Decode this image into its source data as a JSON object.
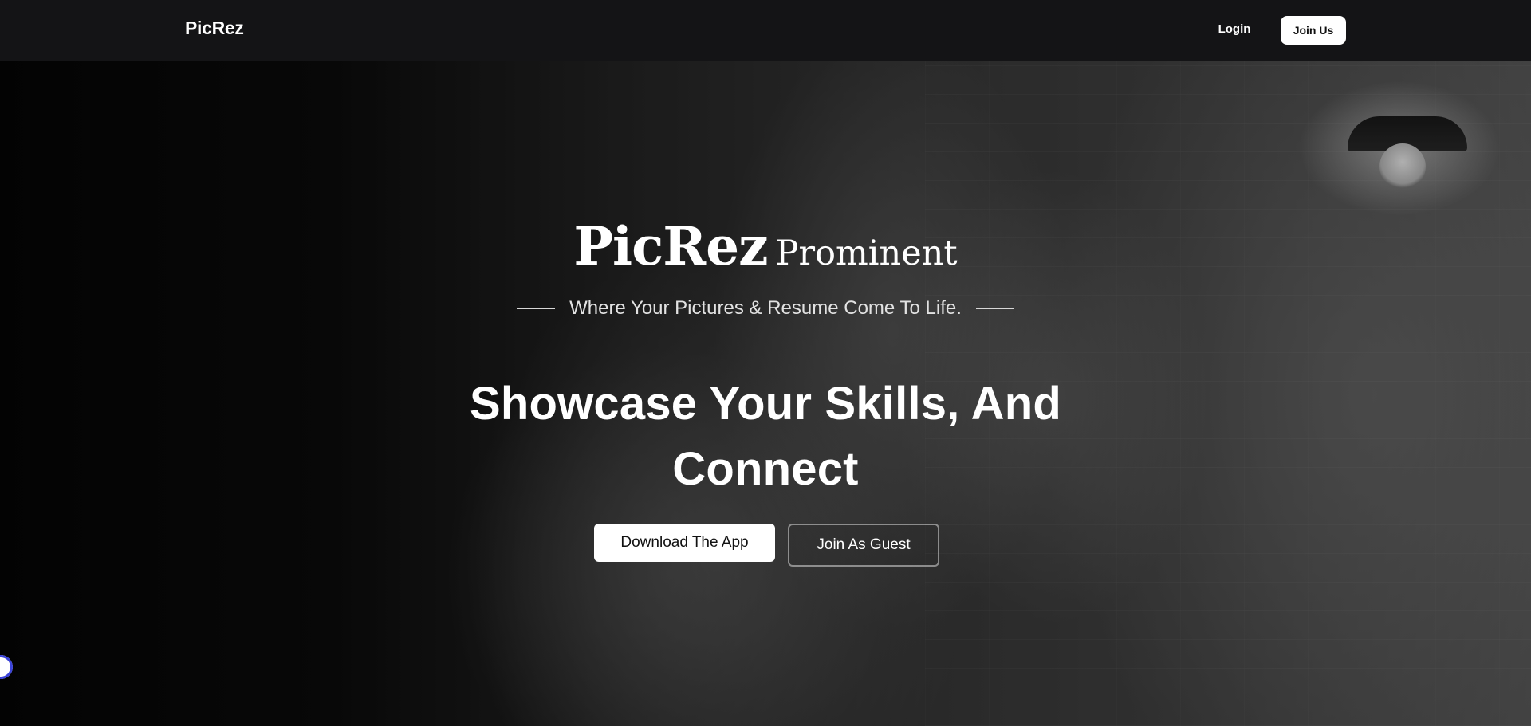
{
  "navbar": {
    "brand": "PicRez",
    "login_label": "Login",
    "join_label": "Join Us"
  },
  "hero": {
    "logo_main": "PicRez",
    "logo_sub": "Prominent",
    "tagline": "Where Your Pictures & Resume Come To Life.",
    "headline_line1": "Showcase Your Skills, And",
    "headline_line2": "Connect",
    "download_label": "Download The App",
    "guest_label": "Join As Guest"
  },
  "colors": {
    "navbar_bg": "#141416",
    "button_bg": "#ffffff",
    "widget_ring": "#3b43d8"
  },
  "icons": {
    "floating_widget": "circle-toggle-icon"
  }
}
